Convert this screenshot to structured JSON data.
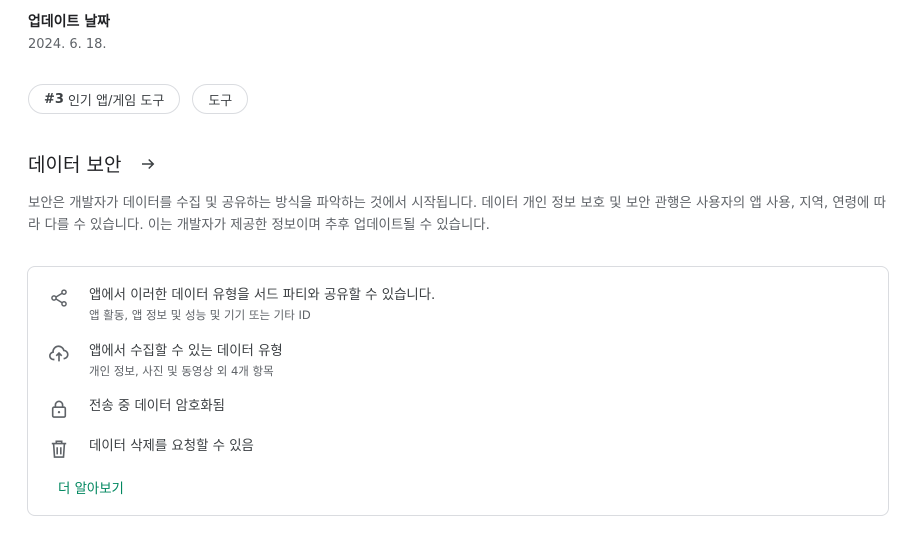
{
  "update": {
    "title": "업데이트 날짜",
    "date": "2024. 6. 18."
  },
  "chips": [
    {
      "rank": "#3",
      "label": "인기 앱/게임 도구"
    },
    {
      "label": "도구"
    }
  ],
  "data_safety": {
    "title": "데이터 보안",
    "description": "보안은 개발자가 데이터를 수집 및 공유하는 방식을 파악하는 것에서 시작됩니다. 데이터 개인 정보 보호 및 보안 관행은 사용자의 앱 사용, 지역, 연령에 따라 다를 수 있습니다. 이는 개발자가 제공한 정보이며 추후 업데이트될 수 있습니다.",
    "items": [
      {
        "icon": "share-icon",
        "main": "앱에서 이러한 데이터 유형을 서드 파티와 공유할 수 있습니다.",
        "sub": "앱 활동, 앱 정보 및 성능 및 기기 또는 기타 ID"
      },
      {
        "icon": "cloud-upload-icon",
        "main": "앱에서 수집할 수 있는 데이터 유형",
        "sub": "개인 정보, 사진 및 동영상 외 4개 항목"
      },
      {
        "icon": "lock-icon",
        "main": "전송 중 데이터 암호화됨"
      },
      {
        "icon": "trash-icon",
        "main": "데이터 삭제를 요청할 수 있음"
      }
    ],
    "learn_more": "더 알아보기"
  },
  "colors": {
    "accent": "#01875f",
    "text_primary": "#202124",
    "text_secondary": "#5f6368",
    "border": "#dadce0"
  }
}
